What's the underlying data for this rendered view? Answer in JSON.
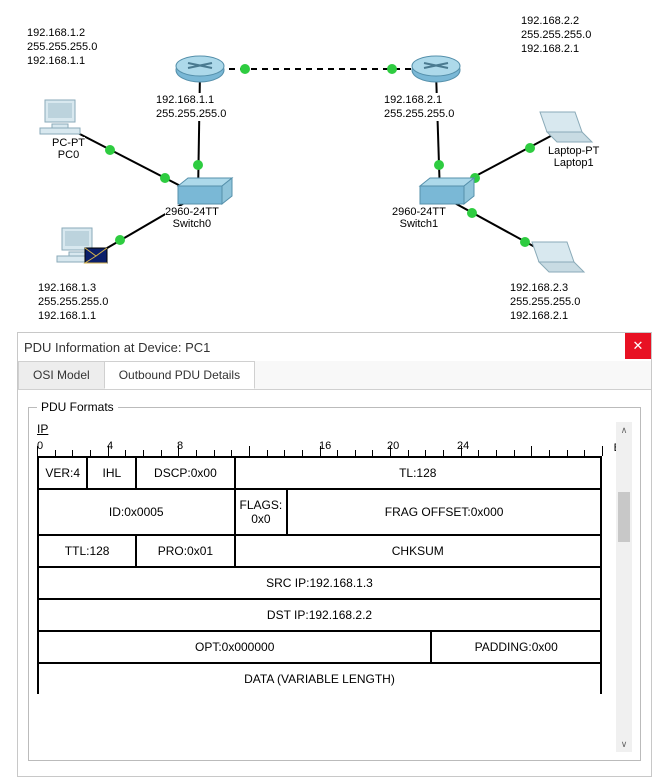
{
  "topology": {
    "pc0_info": {
      "ip": "192.168.1.2",
      "mask": "255.255.255.0",
      "gw": "192.168.1.1"
    },
    "pc0_label_line1": "PC-PT",
    "pc0_label_line2": "PC0",
    "pc1_info": {
      "ip": "192.168.1.3",
      "mask": "255.255.255.0",
      "gw": "192.168.1.1"
    },
    "router0_info": {
      "ip": "192.168.1.1",
      "mask": "255.255.255.0"
    },
    "switch0_line1": "2960-24TT",
    "switch0_line2": "Switch0",
    "router1_info": {
      "ip": "192.168.2.1",
      "mask": "255.255.255.0"
    },
    "switch1_line1": "2960-24TT",
    "switch1_line2": "Switch1",
    "laptop1_info": {
      "ip": "192.168.2.2",
      "mask": "255.255.255.0",
      "gw": "192.168.2.1"
    },
    "laptop1_label_line1": "Laptop-PT",
    "laptop1_label_line2": "Laptop1",
    "laptop2_info": {
      "ip": "192.168.2.3",
      "mask": "255.255.255.0",
      "gw": "192.168.2.1"
    }
  },
  "pdu_window": {
    "title": "PDU Information at Device: PC1",
    "tabs": {
      "osi": "OSI Model",
      "outbound": "Outbound PDU Details"
    },
    "formats_legend": "PDU Formats",
    "ip_header": "IP",
    "ruler": {
      "n0": "0",
      "n4": "4",
      "n8": "8",
      "n16": "16",
      "n20": "20",
      "n24": "24",
      "bits": "Bits"
    },
    "fields": {
      "ver": "VER:4",
      "ihl": "IHL",
      "dscp": "DSCP:0x00",
      "tl": "TL:128",
      "id": "ID:0x0005",
      "flags": "FLAGS: 0x0",
      "frag": "FRAG OFFSET:0x000",
      "ttl": "TTL:128",
      "pro": "PRO:0x01",
      "chksum": "CHKSUM",
      "srcip": "SRC IP:192.168.1.3",
      "dstip": "DST IP:192.168.2.2",
      "opt": "OPT:0x000000",
      "padding": "PADDING:0x00",
      "data": "DATA (VARIABLE LENGTH)"
    }
  }
}
